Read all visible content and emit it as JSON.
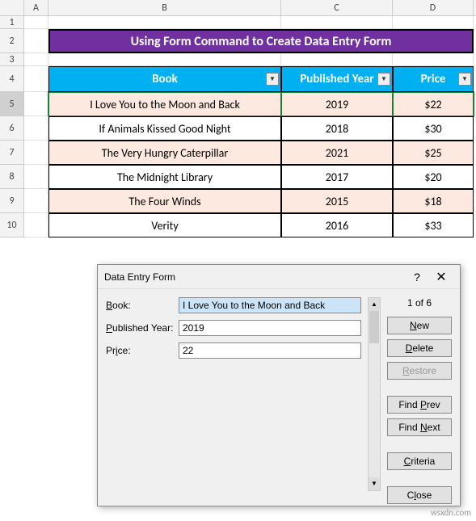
{
  "columns": {
    "a": "A",
    "b": "B",
    "c": "C",
    "d": "D"
  },
  "title": "Using Form Command to Create Data Entry Form",
  "headers": {
    "book": "Book",
    "year": "Published Year",
    "price": "Price"
  },
  "rows": [
    {
      "book": "I Love You to the Moon and Back",
      "year": "2019",
      "price": "$22"
    },
    {
      "book": "If Animals Kissed Good Night",
      "year": "2018",
      "price": "$30"
    },
    {
      "book": "The Very Hungry Caterpillar",
      "year": "2021",
      "price": "$25"
    },
    {
      "book": "The Midnight Library",
      "year": "2017",
      "price": "$20"
    },
    {
      "book": "The Four Winds",
      "year": "2015",
      "price": "$18"
    },
    {
      "book": "Verity",
      "year": "2016",
      "price": "$33"
    }
  ],
  "rowNums": [
    "1",
    "2",
    "3",
    "4",
    "5",
    "6",
    "7",
    "8",
    "9",
    "10"
  ],
  "dialog": {
    "title": "Data Entry Form",
    "labels": {
      "book": "Book:",
      "year": "Published Year:",
      "price": "Price:"
    },
    "values": {
      "book": "I Love You to the Moon and Back",
      "year": "2019",
      "price": "22"
    },
    "counter": "1 of 6",
    "buttons": {
      "new": "New",
      "delete": "Delete",
      "restore": "Restore",
      "findPrev": "Find Prev",
      "findNext": "Find Next",
      "criteria": "Criteria",
      "close": "Close"
    }
  },
  "watermark": "wsxdn.com"
}
